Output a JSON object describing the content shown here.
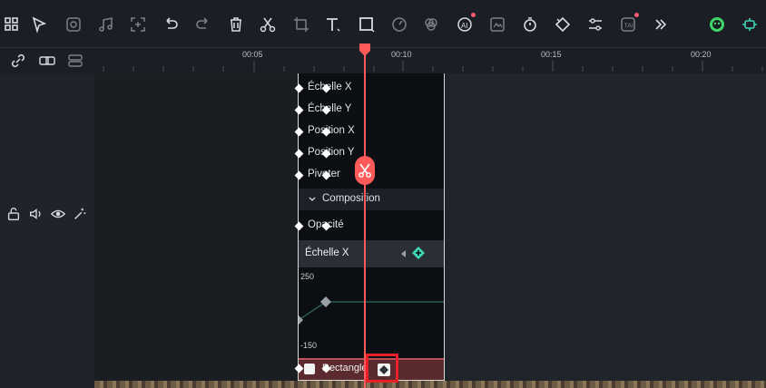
{
  "toolbar": {
    "icons": [
      "grid-icon",
      "select-arrow-icon",
      "ai-sticker-icon",
      "audio-icon",
      "crop-plus-icon",
      "undo-icon",
      "redo-icon",
      "delete-icon",
      "cut-icon",
      "crop-icon",
      "text-icon",
      "rectangle-icon",
      "speed-icon",
      "color-icon",
      "ai-audio-icon",
      "ai-image-icon",
      "timer-icon",
      "keyframe-tag-icon",
      "adjust-icon",
      "ai-text-icon",
      "more-icon",
      "avatar-icon",
      "settings-icon"
    ]
  },
  "ruler": {
    "t1": "00:05",
    "t2": "00:10",
    "t3": "00:15",
    "t4": "00:20"
  },
  "track_controls": {
    "icons": [
      "lock-icon",
      "speaker-icon",
      "eye-icon",
      "magic-icon"
    ]
  },
  "properties": {
    "scale_x": "Échelle X",
    "scale_y": "Échelle Y",
    "position_x": "Position X",
    "position_y": "Position Y",
    "rotate": "Pivoter",
    "composition": "Composition",
    "opacity": "Opacité"
  },
  "curve": {
    "title": "Échelle X",
    "max": "250",
    "min": "-150"
  },
  "clip": {
    "label": "Rectangle"
  },
  "colors": {
    "accent": "#ff5a5a",
    "keyframe_active": "#3ed6b5"
  }
}
